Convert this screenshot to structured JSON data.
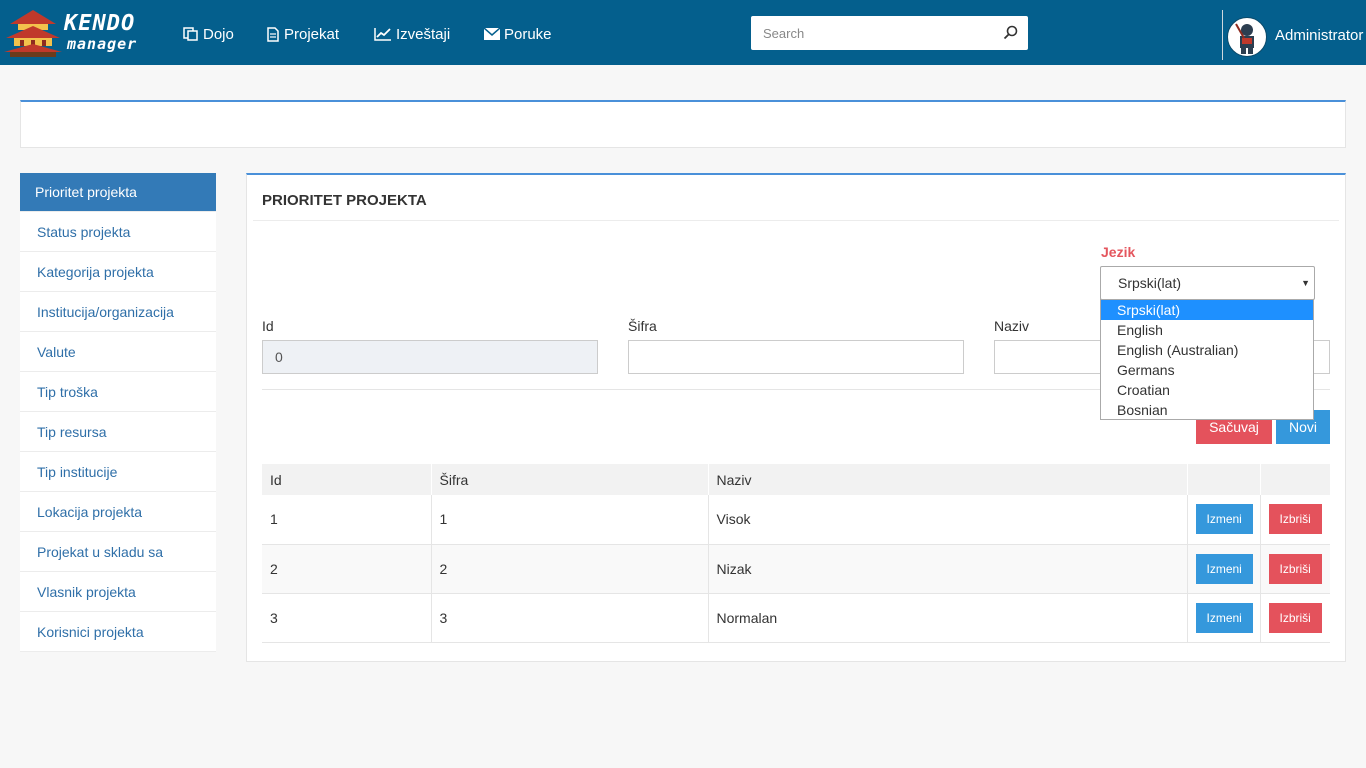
{
  "header": {
    "logo_line1": "KENDO",
    "logo_line2": "manager",
    "nav": [
      {
        "label": "Dojo",
        "icon": "copy-icon"
      },
      {
        "label": "Projekat",
        "icon": "document-icon"
      },
      {
        "label": "Izveštaji",
        "icon": "line-chart-icon"
      },
      {
        "label": "Poruke",
        "icon": "envelope-icon"
      }
    ],
    "search_placeholder": "Search",
    "user_name": "Administrator"
  },
  "sidebar": {
    "items": [
      {
        "label": "Prioritet projekta",
        "active": true
      },
      {
        "label": "Status projekta"
      },
      {
        "label": "Kategorija projekta"
      },
      {
        "label": "Institucija/organizacija"
      },
      {
        "label": "Valute"
      },
      {
        "label": "Tip troška"
      },
      {
        "label": "Tip resursa"
      },
      {
        "label": "Tip institucije"
      },
      {
        "label": "Lokacija projekta"
      },
      {
        "label": "Projekat u skladu sa"
      },
      {
        "label": "Vlasnik projekta"
      },
      {
        "label": "Korisnici projekta"
      }
    ]
  },
  "main": {
    "title": "PRIORITET PROJEKTA",
    "language": {
      "label": "Jezik",
      "selected": "Srpski(lat)",
      "options": [
        "Srpski(lat)",
        "English",
        "English (Australian)",
        "Germans",
        "Croatian",
        "Bosnian"
      ]
    },
    "form": {
      "id_label": "Id",
      "id_value": "0",
      "sifra_label": "Šifra",
      "sifra_value": "",
      "naziv_label": "Naziv",
      "naziv_value": ""
    },
    "buttons": {
      "save": "Sačuvaj",
      "new": "Novi"
    },
    "table": {
      "headers": [
        "Id",
        "Šifra",
        "Naziv",
        "",
        ""
      ],
      "rows": [
        {
          "id": "1",
          "sifra": "1",
          "naziv": "Visok"
        },
        {
          "id": "2",
          "sifra": "2",
          "naziv": "Nizak"
        },
        {
          "id": "3",
          "sifra": "3",
          "naziv": "Normalan"
        }
      ],
      "edit_label": "Izmeni",
      "delete_label": "Izbriši"
    }
  },
  "colors": {
    "navbar": "#045f8d",
    "accent_blue": "#337ab7",
    "button_blue": "#3598dc",
    "button_red": "#e4525c",
    "label_red": "#e4565e"
  }
}
